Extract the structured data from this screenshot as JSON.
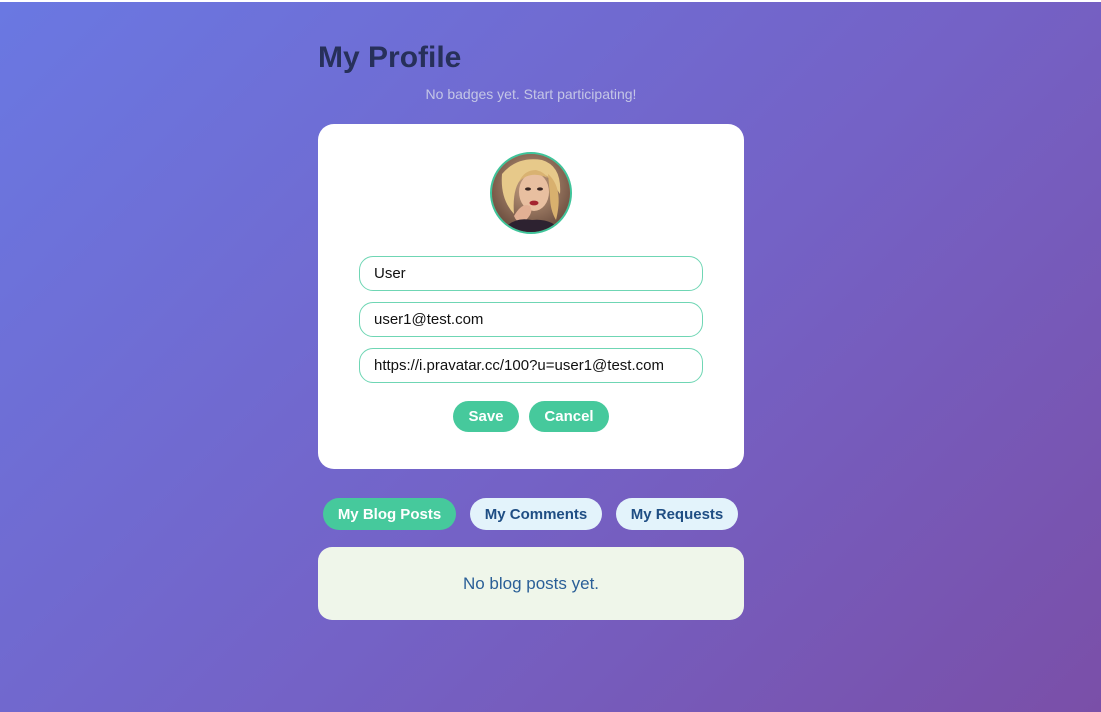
{
  "page": {
    "title": "My Profile",
    "badges_text": "No badges yet. Start participating!"
  },
  "profile_form": {
    "avatar_alt": "User avatar",
    "name_value": "User",
    "email_value": "user1@test.com",
    "avatar_url_value": "https://i.pravatar.cc/100?u=user1@test.com",
    "save_label": "Save",
    "cancel_label": "Cancel"
  },
  "tabs": [
    {
      "label": "My Blog Posts",
      "active": true
    },
    {
      "label": "My Comments",
      "active": false
    },
    {
      "label": "My Requests",
      "active": false
    }
  ],
  "panel": {
    "empty_text": "No blog posts yet."
  },
  "colors": {
    "accent": "#46c99c",
    "title": "#27305a",
    "tab_inactive_bg": "#e3f3fb",
    "tab_inactive_text": "#1f4e84",
    "panel_bg": "#eff6ea",
    "panel_text": "#2a5f97"
  }
}
